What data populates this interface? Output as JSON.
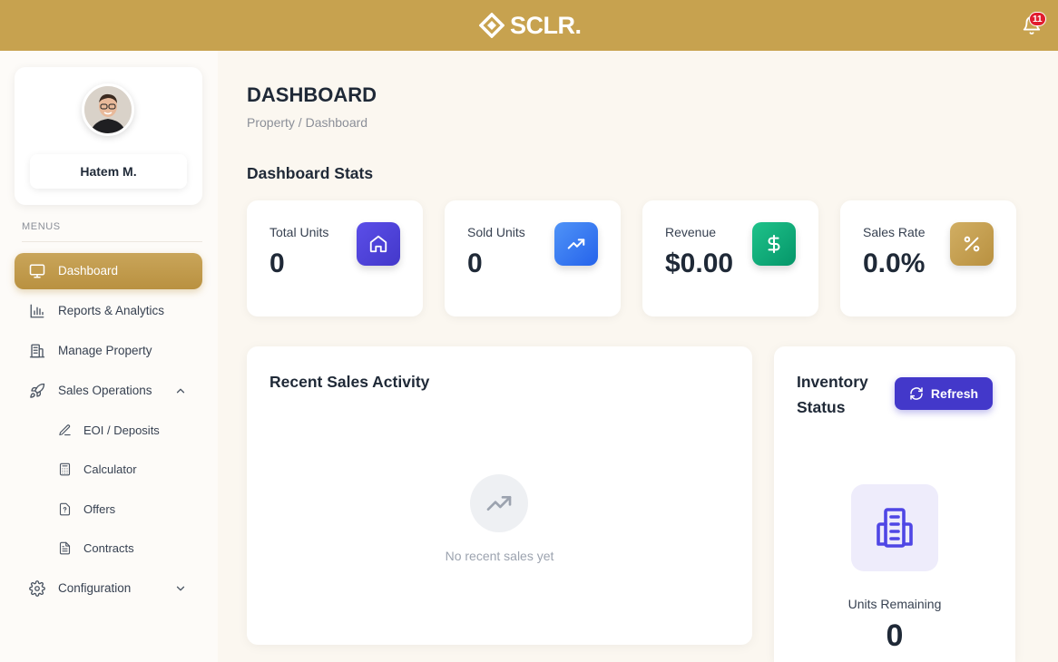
{
  "header": {
    "logo_text": "SCLR.",
    "notification_count": "11",
    "brand_color": "#c7a24f"
  },
  "sidebar": {
    "user_name": "Hatem M.",
    "menus_label": "MENUS",
    "items": [
      {
        "label": "Dashboard",
        "icon": "monitor-icon",
        "active": true
      },
      {
        "label": "Reports & Analytics",
        "icon": "bar-chart-icon"
      },
      {
        "label": "Manage Property",
        "icon": "building-icon"
      },
      {
        "label": "Sales Operations",
        "icon": "rocket-icon",
        "expanded": true
      },
      {
        "label": "Configuration",
        "icon": "gear-icon",
        "expanded": false
      }
    ],
    "sub_items": [
      {
        "label": "EOI / Deposits",
        "icon": "pen-icon"
      },
      {
        "label": "Calculator",
        "icon": "calculator-icon"
      },
      {
        "label": "Offers",
        "icon": "question-file-icon"
      },
      {
        "label": "Contracts",
        "icon": "document-icon"
      }
    ]
  },
  "main": {
    "title": "DASHBOARD",
    "breadcrumb": "Property / Dashboard",
    "stats_title": "Dashboard Stats",
    "stats": [
      {
        "label": "Total Units",
        "value": "0",
        "icon": "home-icon",
        "color": "#4f46e5"
      },
      {
        "label": "Sold Units",
        "value": "0",
        "icon": "trending-up-icon",
        "color": "#3b82f6"
      },
      {
        "label": "Revenue",
        "value": "$0.00",
        "icon": "dollar-icon",
        "color": "#10b981"
      },
      {
        "label": "Sales Rate",
        "value": "0.0%",
        "icon": "percent-icon",
        "color": "#c9a55a"
      }
    ],
    "recent_sales": {
      "title": "Recent Sales Activity",
      "empty_text": "No recent sales yet"
    },
    "inventory": {
      "title": "Inventory Status",
      "refresh_label": "Refresh",
      "units_label": "Units Remaining",
      "units_value": "0"
    }
  }
}
